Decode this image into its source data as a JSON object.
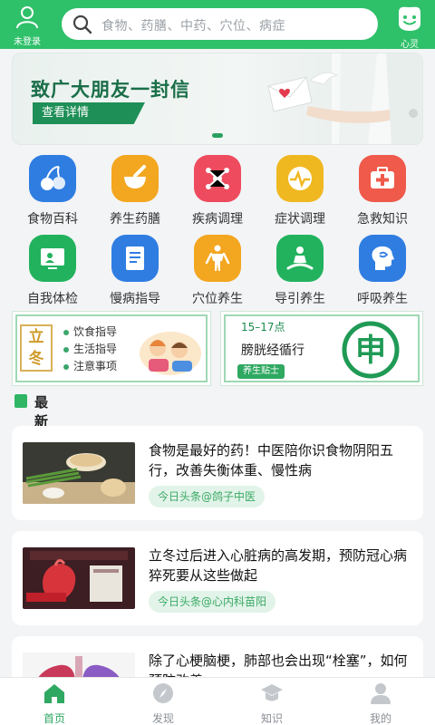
{
  "header": {
    "user_label": "未登录",
    "search_placeholder": "食物、药膳、中药、穴位、病症",
    "right_label": "心灵"
  },
  "banner": {
    "title": "致广大朋友一封信",
    "cta": "查看详情"
  },
  "grid": [
    {
      "label": "食物百科",
      "icon": "cherry-icon",
      "color": "#2f7de1"
    },
    {
      "label": "养生药膳",
      "icon": "mortar-icon",
      "color": "#f3a61f"
    },
    {
      "label": "疾病调理",
      "icon": "molecule-icon",
      "color": "#ef4b5e"
    },
    {
      "label": "症状调理",
      "icon": "pulse-icon",
      "color": "#f0b820"
    },
    {
      "label": "急救知识",
      "icon": "first-aid-kit-icon",
      "color": "#ef5a4a"
    },
    {
      "label": "自我体检",
      "icon": "monitor-icon",
      "color": "#22b25d"
    },
    {
      "label": "慢病指导",
      "icon": "document-icon",
      "color": "#2f7de1"
    },
    {
      "label": "穴位养生",
      "icon": "body-icon",
      "color": "#f3a61f"
    },
    {
      "label": "导引养生",
      "icon": "meditation-icon",
      "color": "#22b25d"
    },
    {
      "label": "呼吸养生",
      "icon": "head-breath-icon",
      "color": "#2f7de1"
    }
  ],
  "promo_left": {
    "term": "立冬",
    "items": [
      "饮食指导",
      "生活指导",
      "注意事项"
    ]
  },
  "promo_right": {
    "time": "15–17点",
    "meridian": "膀胱经循行",
    "tag": "养生贴士",
    "stamp": "申"
  },
  "section": {
    "title": "最新知识"
  },
  "news": [
    {
      "title": "食物是最好的药！中医陪你识食物阴阳五行，改善失衡体重、慢性病",
      "source": "今日头条@鸽子中医"
    },
    {
      "title": "立冬过后进入心脏病的高发期，预防冠心病猝死要从这些做起",
      "source": "今日头条@心内科苗阳"
    },
    {
      "title": "除了心梗脑梗，肺部也会出现“栓塞”，如何预防改善",
      "source": ""
    }
  ],
  "tabs": [
    {
      "label": "首页",
      "active": true
    },
    {
      "label": "发现",
      "active": false
    },
    {
      "label": "知识",
      "active": false
    },
    {
      "label": "我的",
      "active": false
    }
  ],
  "colors": {
    "brand": "#2fc06a",
    "accent": "#2fa862"
  }
}
